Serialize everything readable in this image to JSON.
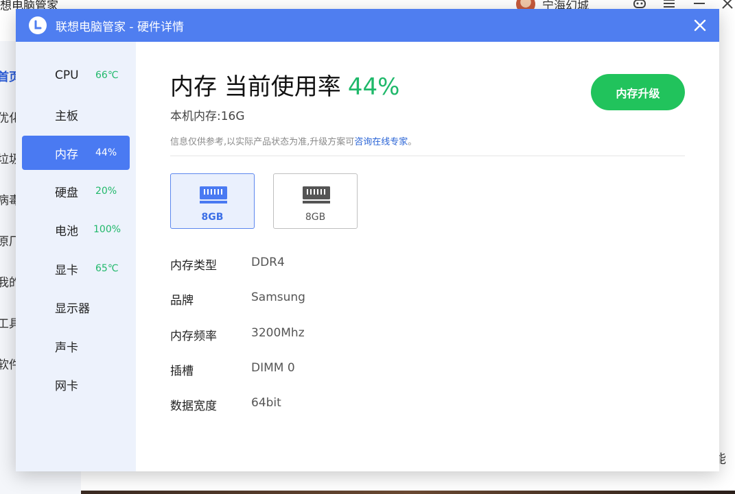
{
  "background_app": {
    "title": "想电脑管家",
    "nav_items": [
      {
        "label": "首页",
        "active": true
      },
      {
        "label": "优化",
        "active": false
      },
      {
        "label": "垃圾",
        "active": false
      },
      {
        "label": "病毒",
        "active": false
      },
      {
        "label": "原厂",
        "active": false
      },
      {
        "label": "我的",
        "active": false
      },
      {
        "label": "工具",
        "active": false
      },
      {
        "label": "软件",
        "active": false
      }
    ],
    "user_name": "宁海幻城",
    "side_glyph": "能"
  },
  "dialog": {
    "title": "联想电脑管家 - 硬件详情",
    "close_icon": "close-icon",
    "accent_color": "#4f7ef0"
  },
  "sidebar": {
    "items": [
      {
        "label": "CPU",
        "value": "66℃",
        "active": false
      },
      {
        "label": "主板",
        "value": "",
        "active": false
      },
      {
        "label": "内存",
        "value": "44%",
        "active": true
      },
      {
        "label": "硬盘",
        "value": "20%",
        "active": false
      },
      {
        "label": "电池",
        "value": "100%",
        "active": false
      },
      {
        "label": "显卡",
        "value": "65℃",
        "active": false
      },
      {
        "label": "显示器",
        "value": "",
        "active": false
      },
      {
        "label": "声卡",
        "value": "",
        "active": false
      },
      {
        "label": "网卡",
        "value": "",
        "active": false
      }
    ]
  },
  "memory": {
    "heading": "内存 当前使用率",
    "usage": "44%",
    "installed": "本机内存:16G",
    "notice_prefix": "信息仅供参考,以实际产品状态为准,升级方案可",
    "notice_link": "咨询在线专家",
    "notice_suffix": "。",
    "upgrade_button": "内存升级",
    "upgrade_color": "#21c35c",
    "modules": [
      {
        "label": "8GB",
        "selected": true
      },
      {
        "label": "8GB",
        "selected": false
      }
    ],
    "specs": [
      {
        "label": "内存类型",
        "value": "DDR4"
      },
      {
        "label": "品牌",
        "value": "Samsung"
      },
      {
        "label": "内存频率",
        "value": "3200Mhz"
      },
      {
        "label": "插槽",
        "value": "DIMM 0"
      },
      {
        "label": "数据宽度",
        "value": "64bit"
      }
    ]
  }
}
